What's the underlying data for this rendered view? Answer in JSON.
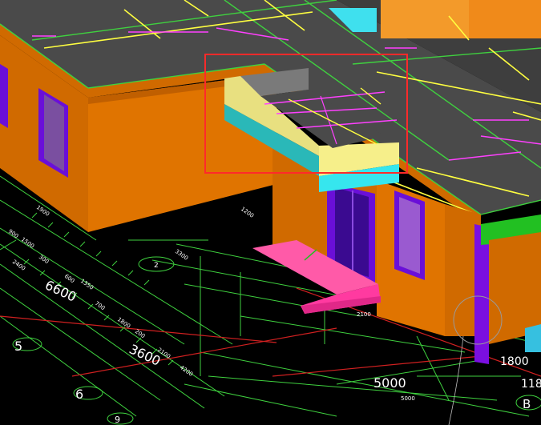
{
  "viewport": {
    "background": "#000000",
    "colors": {
      "roof": "#4a4a4a",
      "wall": "#d06a00",
      "window_frame": "#6a0fd8",
      "window_glass": "#7a4fa0",
      "canopy_top": "#f6ef8a",
      "canopy_band": "#36e6ee",
      "selection": "#ff2a2a",
      "grid_green": "#3fd13f",
      "grid_red": "#d02020",
      "rebar_magenta": "#ff40ff",
      "rebar_yellow": "#ffff40",
      "step_pink": "#ff5aa8",
      "beam_green": "#22c022"
    }
  },
  "axis_bubbles": [
    {
      "label": "5"
    },
    {
      "label": "6"
    },
    {
      "label": "9"
    },
    {
      "label": "2"
    },
    {
      "label": "B"
    }
  ],
  "dimensions": {
    "large": [
      "6600",
      "3600",
      "5000",
      "1800",
      "118"
    ],
    "small": [
      "5000",
      "2100",
      "1900",
      "1200",
      "900",
      "1500",
      "2400",
      "300",
      "600",
      "1350",
      "700",
      "1800",
      "200",
      "2100",
      "4200",
      "3300"
    ]
  }
}
